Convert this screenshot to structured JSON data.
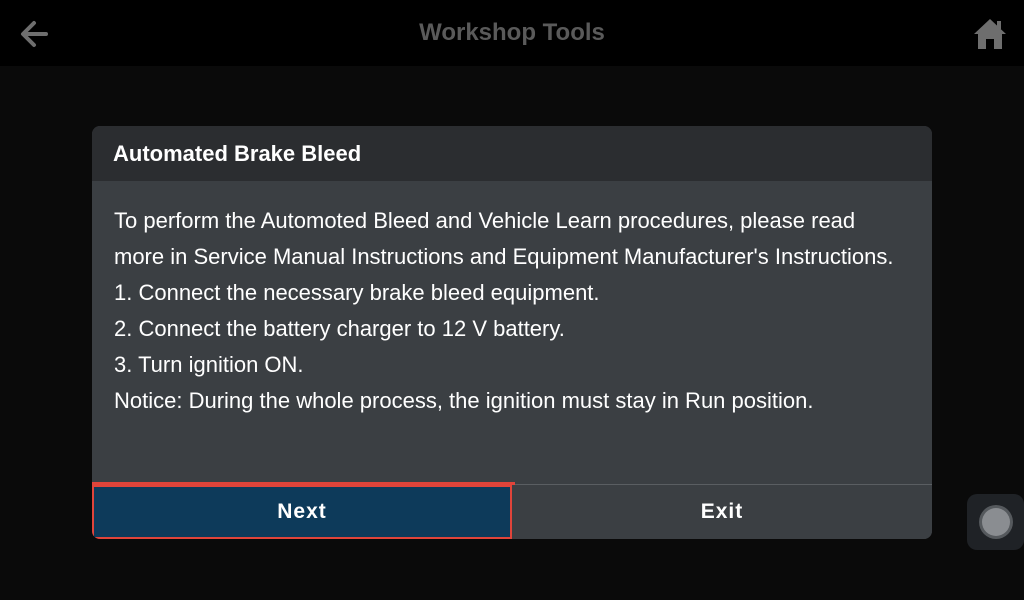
{
  "header": {
    "title": "Workshop Tools",
    "back_icon": "arrow-left-icon",
    "home_icon": "home-icon"
  },
  "dialog": {
    "title": "Automated Brake Bleed",
    "body": {
      "intro": "To perform the Automoted Bleed and Vehicle Learn procedures, please read more in Service Manual Instructions and Equipment Manufacturer's Instructions.",
      "step1": "1. Connect the necessary brake bleed equipment.",
      "step2": "2. Connect the battery charger to 12 V battery.",
      "step3": "3. Turn ignition ON.",
      "notice": "Notice: During the whole process, the ignition must stay in Run position."
    },
    "buttons": {
      "next": "Next",
      "exit": "Exit"
    }
  },
  "floating_button": {
    "icon": "assistive-touch-icon"
  },
  "colors": {
    "topbar_bg": "#000000",
    "dialog_bg": "#3b3f43",
    "dialog_header_bg": "#2b2d30",
    "next_button_bg": "#0d3a5a",
    "highlight_border": "#e0443a",
    "title_text": "#5a5a5a"
  }
}
